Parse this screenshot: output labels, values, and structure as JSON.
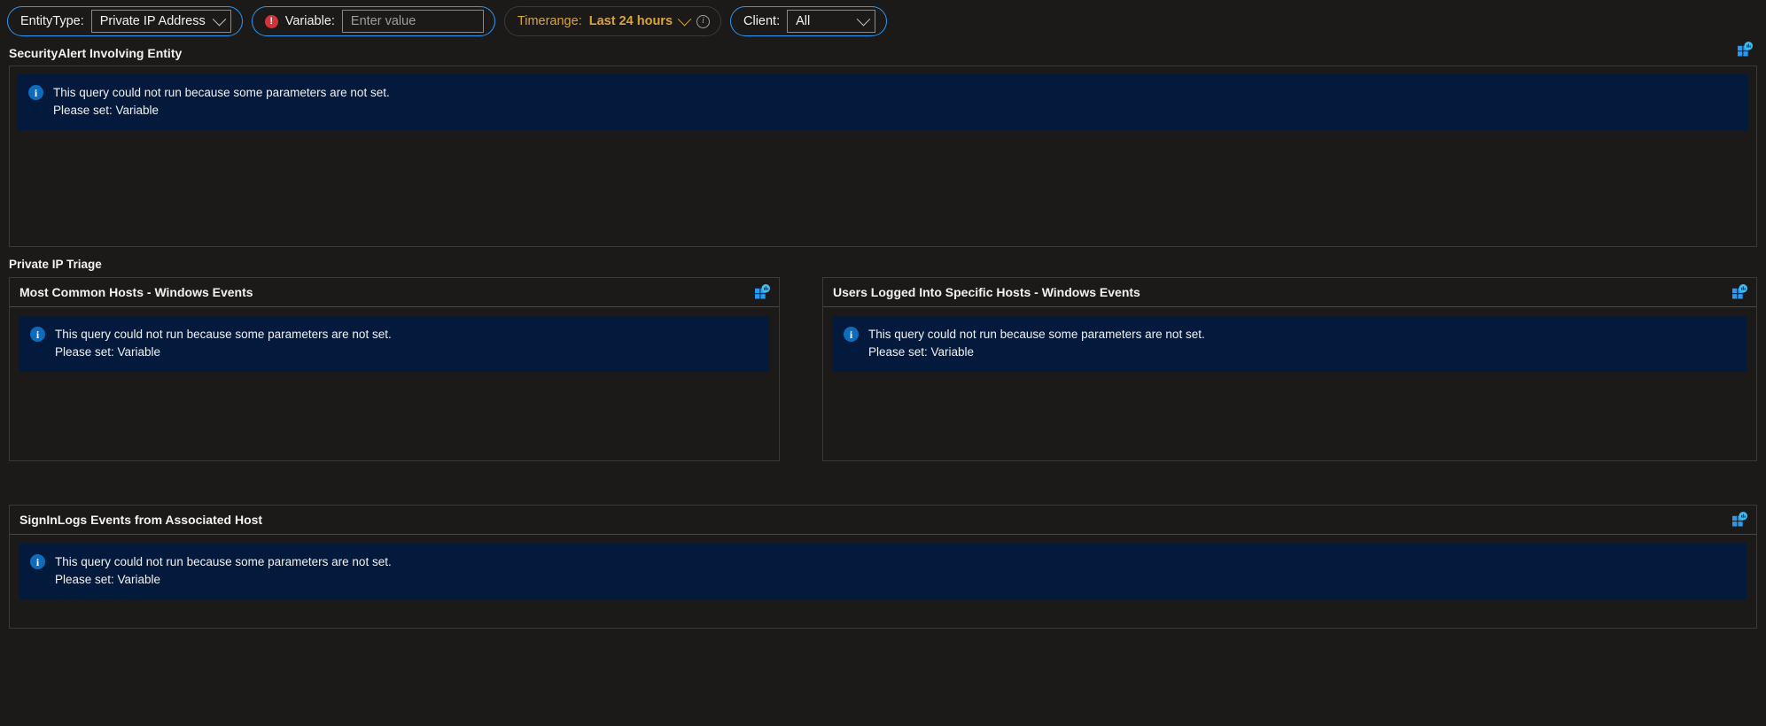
{
  "params": {
    "entity_type": {
      "label": "EntityType:",
      "value": "Private IP Address",
      "chevron": "chevron-down-icon"
    },
    "variable": {
      "error_icon": "error-icon",
      "label": "Variable:",
      "value": "",
      "placeholder": "Enter value"
    },
    "timerange": {
      "label": "Timerange:",
      "value": "Last 24 hours",
      "chevron": "chevron-down-icon",
      "info_icon": "info-icon"
    },
    "client": {
      "label": "Client:",
      "value": "All",
      "chevron": "chevron-down-icon"
    }
  },
  "messages": {
    "line1": "This query could not run because some parameters are not set.",
    "line2": "Please set: Variable",
    "icon": "info-icon"
  },
  "sections": [
    {
      "title": "SecurityAlert Involving Entity",
      "chart_icon": "add-chart-icon"
    }
  ],
  "group": {
    "title": "Private IP Triage"
  },
  "panels": {
    "most_common_hosts": {
      "title": "Most Common Hosts - Windows Events",
      "chart_icon": "add-chart-icon"
    },
    "users_logged_in": {
      "title": "Users Logged Into Specific Hosts - Windows Events",
      "chart_icon": "add-chart-icon"
    },
    "signinlogs": {
      "title": "SignInLogs Events from Associated Host",
      "chart_icon": "add-chart-icon"
    }
  },
  "colors": {
    "background": "#1b1a19",
    "banner_background": "#031a3d",
    "accent_blue": "#2899f5",
    "info_blue": "#0f6cbd",
    "error_red": "#d13438",
    "gold": "#d9a43a",
    "border": "#3b3a39"
  }
}
